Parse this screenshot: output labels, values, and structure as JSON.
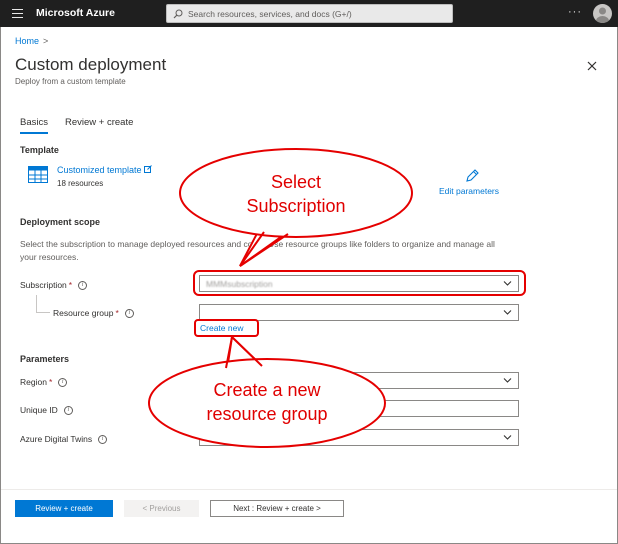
{
  "topbar": {
    "brand": "Microsoft Azure",
    "search_placeholder": "Search resources, services, and docs (G+/)",
    "more": "···"
  },
  "header": {
    "breadcrumb": "Home",
    "breadcrumb_sep": ">",
    "title": "Custom deployment",
    "subtitle": "Deploy from a custom template"
  },
  "tabs": [
    {
      "label": "Basics",
      "active": true
    },
    {
      "label": "Review + create",
      "active": false
    }
  ],
  "template": {
    "heading": "Template",
    "link": "Customized template",
    "count": "18 resources",
    "edit_label": "Edit parameters"
  },
  "scope": {
    "heading": "Deployment scope",
    "description": "Select the subscription to manage deployed resources and costs. Use resource groups like folders to organize and manage all your resources.",
    "subscription_label": "Subscription",
    "subscription_value": "MMMsubscription",
    "resource_group_label": "Resource group",
    "resource_group_value": "",
    "create_new": "Create new"
  },
  "parameters": {
    "heading": "Parameters",
    "region_label": "Region",
    "region_value": "",
    "unique_id_label": "Unique ID",
    "unique_id_value": "",
    "adt_label": "Azure Digital Twins",
    "adt_value": ""
  },
  "footer": {
    "review_create": "Review + create",
    "previous": "< Previous",
    "next": "Next : Review + create >"
  },
  "callouts": {
    "top": [
      "Select",
      "Subscription"
    ],
    "bottom": [
      "Create a new",
      "resource group"
    ]
  },
  "colors": {
    "accent": "#0078d4",
    "topbar": "#1f1f1f",
    "annotation": "#e50000"
  }
}
